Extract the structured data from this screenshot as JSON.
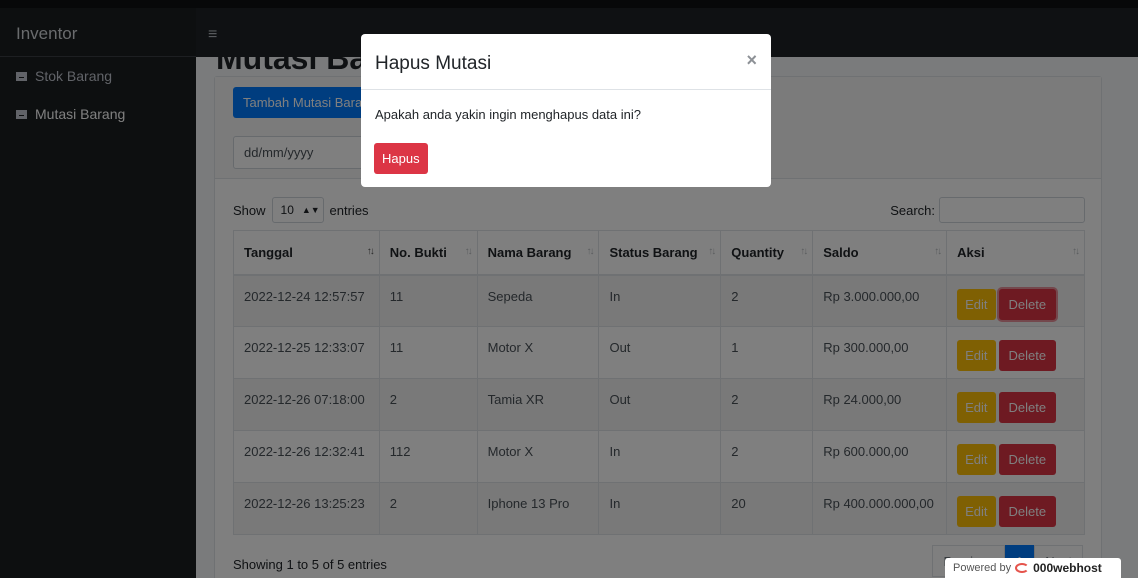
{
  "sidebar": {
    "brand": "Inventor",
    "items": [
      {
        "label": "Stok Barang"
      },
      {
        "label": "Mutasi Barang"
      }
    ]
  },
  "topbar": {
    "menu_icon": "hamburger-icon"
  },
  "page": {
    "heading": "Mutasi Barang"
  },
  "toolbar": {
    "add_label": "Tambah Mutasi Barang",
    "date_placeholder": "dd/mm/yyyy"
  },
  "datatable": {
    "show_label": "Show",
    "length_value": "10",
    "entries_label": "entries",
    "search_label": "Search:",
    "columns": [
      "Tanggal",
      "No. Bukti",
      "Nama Barang",
      "Status Barang",
      "Quantity",
      "Saldo",
      "Aksi"
    ],
    "rows": [
      {
        "tanggal": "2022-12-24 12:57:57",
        "bukti": "11",
        "nama": "Sepeda",
        "status": "In",
        "qty": "2",
        "saldo": "Rp 3.000.000,00"
      },
      {
        "tanggal": "2022-12-25 12:33:07",
        "bukti": "11",
        "nama": "Motor X",
        "status": "Out",
        "qty": "1",
        "saldo": "Rp 300.000,00"
      },
      {
        "tanggal": "2022-12-26 07:18:00",
        "bukti": "2",
        "nama": "Tamia XR",
        "status": "Out",
        "qty": "2",
        "saldo": "Rp 24.000,00"
      },
      {
        "tanggal": "2022-12-26 12:32:41",
        "bukti": "112",
        "nama": "Motor X",
        "status": "In",
        "qty": "2",
        "saldo": "Rp 600.000,00"
      },
      {
        "tanggal": "2022-12-26 13:25:23",
        "bukti": "2",
        "nama": "Iphone 13 Pro",
        "status": "In",
        "qty": "20",
        "saldo": "Rp 400.000.000,00"
      }
    ],
    "edit_label": "Edit",
    "delete_label": "Delete",
    "info": "Showing 1 to 5 of 5 entries",
    "pager": {
      "prev": "Previous",
      "current": "1",
      "next": "Next"
    }
  },
  "modal": {
    "title": "Hapus Mutasi",
    "close": "×",
    "body": "Apakah anda yakin ingin menghapus data ini?",
    "confirm_label": "Hapus"
  },
  "watermark": {
    "prefix": "Powered by",
    "host": "000webhost"
  },
  "colors": {
    "primary": "#007bff",
    "danger": "#dc3545",
    "warning": "#ffc107",
    "sidebar": "#1b1e21"
  }
}
